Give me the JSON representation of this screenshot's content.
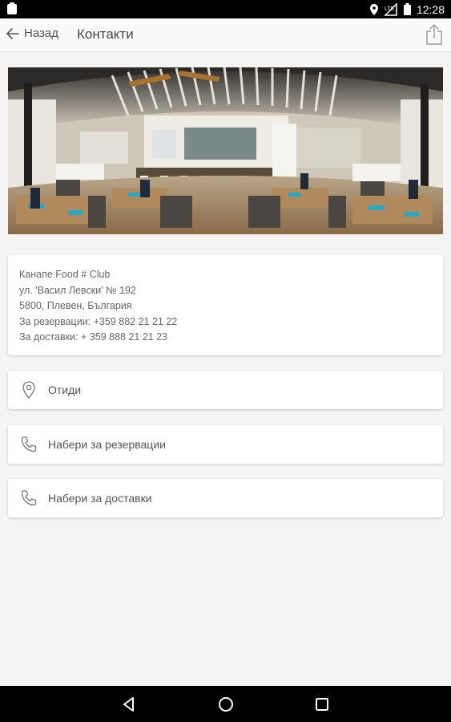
{
  "status_bar": {
    "time": "12:28",
    "icons": [
      "notification-icon",
      "location-icon",
      "no-signal-icon",
      "battery-icon"
    ]
  },
  "app_bar": {
    "back_label": "Назад",
    "title": "Контакти",
    "share_icon": "share-icon"
  },
  "hero": {
    "alt": "Restaurant interior panorama"
  },
  "info": {
    "name": "Канапе Food # Club",
    "street": "ул. 'Васил Левски' № 192",
    "city": "5800, Плевен, България",
    "reservations": "За резервации: +359 882 21 21 22",
    "deliveries": "За доставки: + 359 888 21 21 23"
  },
  "actions": [
    {
      "label": "Отиди",
      "icon": "location-pin-icon"
    },
    {
      "label": "Набери за резервации",
      "icon": "phone-icon"
    },
    {
      "label": "Набери за доставки",
      "icon": "phone-icon"
    }
  ],
  "nav_bar": {
    "buttons": [
      "back-triangle-icon",
      "home-circle-icon",
      "recents-square-icon"
    ]
  },
  "colors": {
    "background": "#f4f4f4",
    "card": "#ffffff",
    "text": "#555555",
    "bars": "#000000"
  }
}
